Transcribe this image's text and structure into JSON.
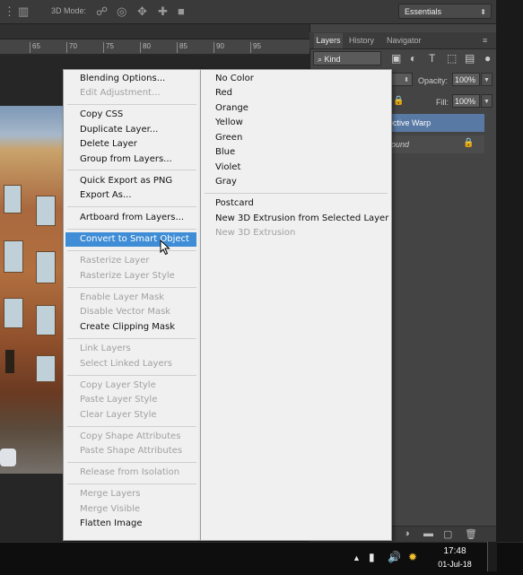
{
  "toolbar": {
    "mode_label": "3D Mode:",
    "workspace": "Essentials",
    "icons": [
      "arrange-icon",
      "orbit-3d-icon",
      "roll-3d-icon",
      "drag-3d-icon",
      "pan-3d-icon",
      "video-camera-icon"
    ]
  },
  "ruler": {
    "ticks": [
      "65",
      "70",
      "75",
      "80",
      "85",
      "90",
      "95"
    ]
  },
  "panel": {
    "tabs": [
      "Layers",
      "History",
      "Navigator"
    ],
    "filter_kind": "Kind",
    "opacity_label": "Opacity:",
    "opacity_value": "100%",
    "fill_label": "Fill:",
    "fill_value": "100%",
    "layers": [
      {
        "name": "ective Warp",
        "selected": true
      },
      {
        "name": "round",
        "locked": true
      }
    ]
  },
  "context_menu": {
    "items": [
      {
        "label": "Blending Options...",
        "enabled": true
      },
      {
        "label": "Edit Adjustment...",
        "enabled": false
      },
      {
        "label": "Copy CSS",
        "enabled": true
      },
      {
        "label": "Duplicate Layer...",
        "enabled": true
      },
      {
        "label": "Delete Layer",
        "enabled": true
      },
      {
        "label": "Group from Layers...",
        "enabled": true
      },
      {
        "label": "Quick Export as PNG",
        "enabled": true
      },
      {
        "label": "Export As...",
        "enabled": true
      },
      {
        "label": "Artboard from Layers...",
        "enabled": true
      },
      {
        "label": "Convert to Smart Object",
        "enabled": true,
        "highlighted": true
      },
      {
        "label": "Rasterize Layer",
        "enabled": false
      },
      {
        "label": "Rasterize Layer Style",
        "enabled": false
      },
      {
        "label": "Enable Layer Mask",
        "enabled": false
      },
      {
        "label": "Disable Vector Mask",
        "enabled": false
      },
      {
        "label": "Create Clipping Mask",
        "enabled": true
      },
      {
        "label": "Link Layers",
        "enabled": false
      },
      {
        "label": "Select Linked Layers",
        "enabled": false
      },
      {
        "label": "Copy Layer Style",
        "enabled": false
      },
      {
        "label": "Paste Layer Style",
        "enabled": false
      },
      {
        "label": "Clear Layer Style",
        "enabled": false
      },
      {
        "label": "Copy Shape Attributes",
        "enabled": false
      },
      {
        "label": "Paste Shape Attributes",
        "enabled": false
      },
      {
        "label": "Release from Isolation",
        "enabled": false
      },
      {
        "label": "Merge Layers",
        "enabled": false
      },
      {
        "label": "Merge Visible",
        "enabled": false
      },
      {
        "label": "Flatten Image",
        "enabled": true
      }
    ]
  },
  "submenu": {
    "items": [
      {
        "label": "No Color",
        "enabled": true
      },
      {
        "label": "Red",
        "enabled": true
      },
      {
        "label": "Orange",
        "enabled": true
      },
      {
        "label": "Yellow",
        "enabled": true
      },
      {
        "label": "Green",
        "enabled": true
      },
      {
        "label": "Blue",
        "enabled": true
      },
      {
        "label": "Violet",
        "enabled": true
      },
      {
        "label": "Gray",
        "enabled": true
      },
      {
        "label": "Postcard",
        "enabled": true
      },
      {
        "label": "New 3D Extrusion from Selected Layer",
        "enabled": true
      },
      {
        "label": "New 3D Extrusion",
        "enabled": false
      }
    ]
  },
  "taskbar": {
    "time": "17:48",
    "date": "01-Jul-18"
  },
  "colors": {
    "menu_highlight": "#3f8dd6",
    "selected_layer": "#5879a3"
  }
}
